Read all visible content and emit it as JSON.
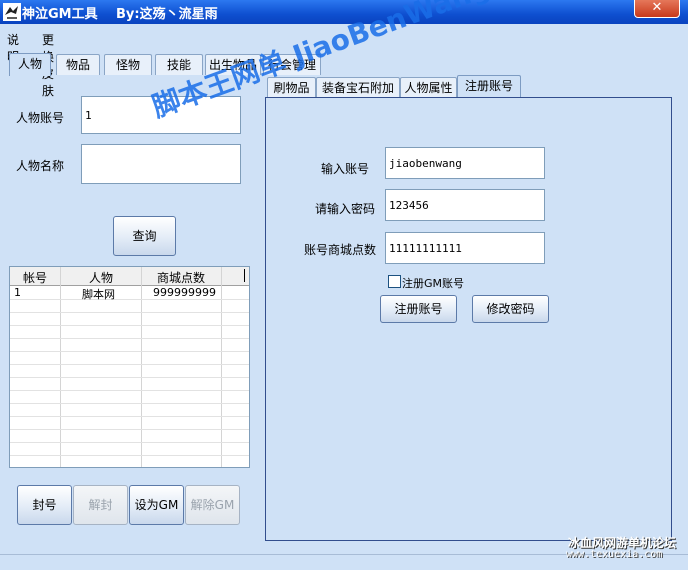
{
  "window": {
    "title": "神泣GM工具",
    "author": "By:这殇丶流星雨",
    "close_glyph": "✕"
  },
  "menu": {
    "items": [
      "说明",
      "更换皮肤"
    ]
  },
  "main_tabs": [
    "人物",
    "物品",
    "怪物",
    "技能",
    "出生物品",
    "行会管理"
  ],
  "left": {
    "account_label": "人物账号",
    "account_value": "1",
    "name_label": "人物名称",
    "name_value": "",
    "query_button": "查询",
    "grid": {
      "headers": [
        "帐号",
        "人物",
        "商城点数"
      ],
      "rows": [
        [
          "1",
          "脚本网",
          "999999999"
        ]
      ]
    },
    "buttons": [
      "封号",
      "解封",
      "设为GM",
      "解除GM"
    ]
  },
  "sub_tabs": [
    "刷物品",
    "装备宝石附加",
    "人物属性",
    "注册账号"
  ],
  "register": {
    "account_label": "输入账号",
    "account_value": "jiaobenwang",
    "password_label": "请输入密码",
    "password_value": "123456",
    "points_label": "账号商城点数",
    "points_value": "11111111111",
    "gm_checkbox_label": "注册GM账号",
    "gm_checked": false,
    "register_button": "注册账号",
    "change_password_button": "修改密码"
  },
  "watermarks": {
    "main": "脚本王网单 JiaoBenWang.Com",
    "site": "冰血风网游单机论坛",
    "url": "www.texuexia.com"
  }
}
